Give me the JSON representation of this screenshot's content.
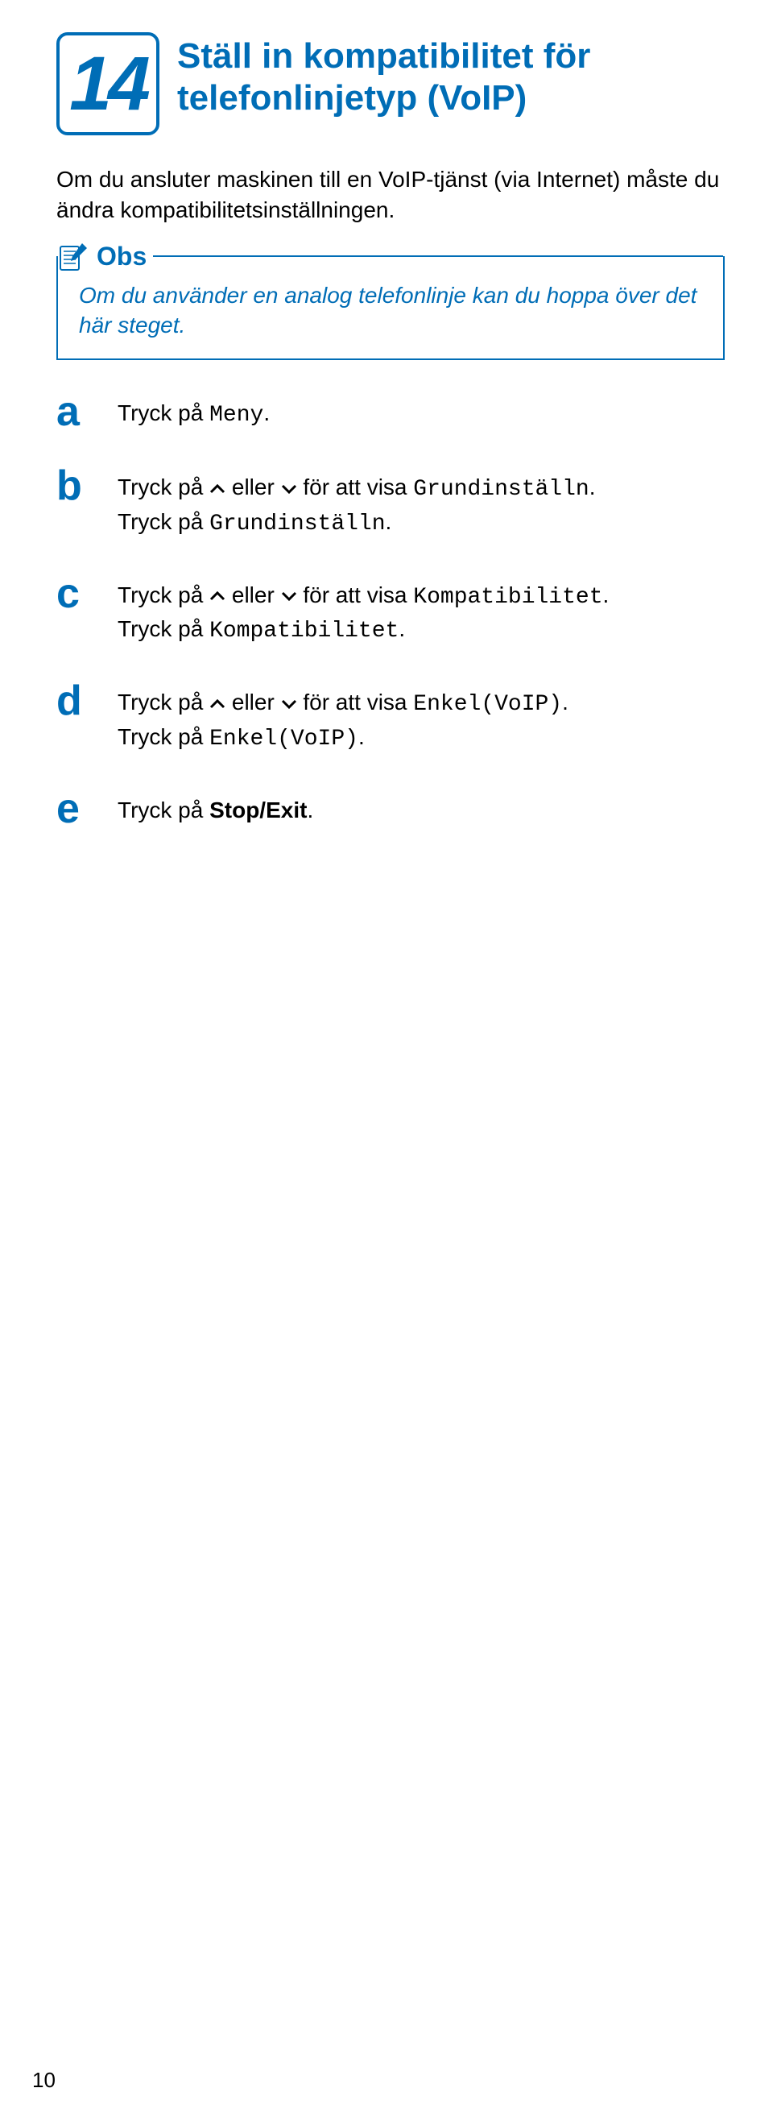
{
  "step_number": "14",
  "section_title": "Ställ in kompatibilitet för telefonlinjetyp (VoIP)",
  "intro": "Om du ansluter maskinen till en VoIP-tjänst (via Internet) måste du ändra kompatibilitetsinställningen.",
  "note": {
    "label": "Obs",
    "body": "Om du använder en analog telefonlinje kan du hoppa över det här steget."
  },
  "steps": {
    "a": {
      "letter": "a",
      "t1": "Tryck på ",
      "m1": "Meny",
      "t2": "."
    },
    "b": {
      "letter": "b",
      "t1": "Tryck på ",
      "t2": " eller ",
      "t3": " för att visa ",
      "m1": "Grundinställn",
      "t4": ".",
      "t5": "Tryck på ",
      "m2": "Grundinställn",
      "t6": "."
    },
    "c": {
      "letter": "c",
      "t1": "Tryck på ",
      "t2": " eller ",
      "t3": " för att visa ",
      "m1": "Kompatibilitet",
      "t4": ".",
      "t5": "Tryck på ",
      "m2": "Kompatibilitet",
      "t6": "."
    },
    "d": {
      "letter": "d",
      "t1": "Tryck på ",
      "t2": " eller ",
      "t3": " för att visa ",
      "m1": "Enkel(VoIP)",
      "t4": ".",
      "t5": "Tryck på ",
      "m2": "Enkel(VoIP)",
      "t6": "."
    },
    "e": {
      "letter": "e",
      "t1": "Tryck på ",
      "b1": "Stop/Exit",
      "t2": "."
    }
  },
  "page_number": "10"
}
